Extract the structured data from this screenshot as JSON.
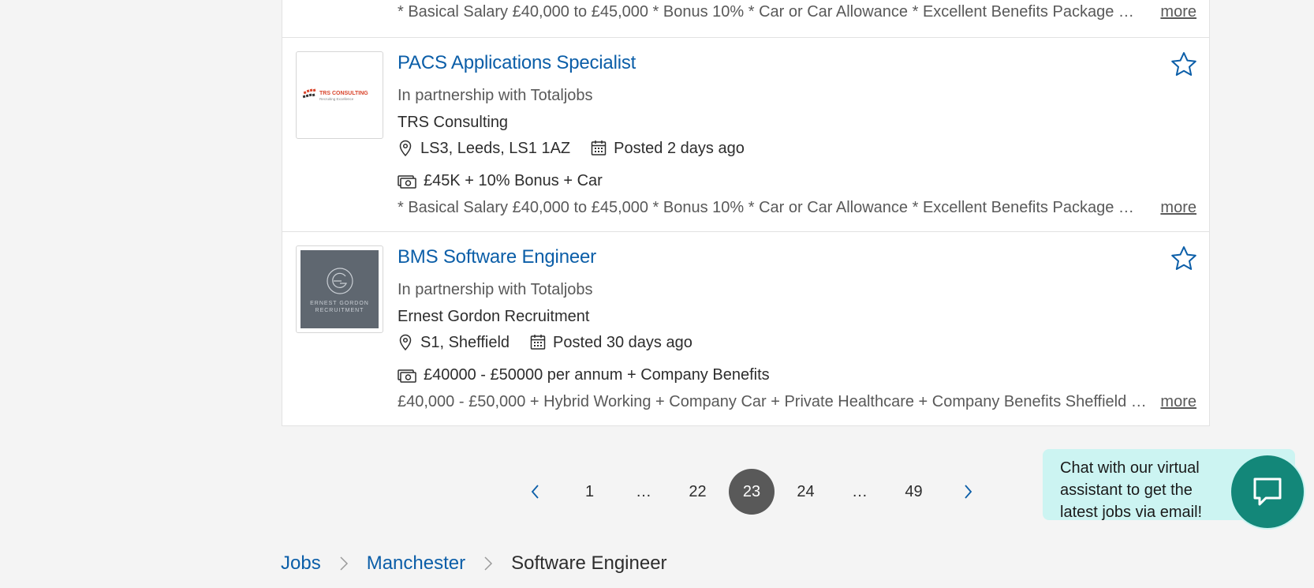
{
  "jobs": [
    {
      "partial": true,
      "description": "* Basical Salary £40,000 to £45,000 * Bonus 10% * Car or Car Allowance * Excellent Benefits Package …",
      "more_label": "more"
    },
    {
      "title": "PACS Applications Specialist",
      "partner": "In partnership with Totaljobs",
      "company": "TRS Consulting",
      "location": "LS3, Leeds, LS1 1AZ",
      "posted": "Posted 2 days ago",
      "salary": "£45K + 10% Bonus + Car",
      "description": "* Basical Salary £40,000 to £45,000 * Bonus 10% * Car or Car Allowance * Excellent Benefits Package …",
      "more_label": "more",
      "logo": {
        "name": "TRS CONSULTING",
        "tagline": "Recruiting Excellence"
      }
    },
    {
      "title": "BMS Software Engineer",
      "partner": "In partnership with Totaljobs",
      "company": "Ernest Gordon Recruitment",
      "location": "S1, Sheffield",
      "posted": "Posted 30 days ago",
      "salary": "£40000 - £50000 per annum + Company Benefits",
      "description": "£40,000 - £50,000 + Hybrid Working + Company Car + Private Healthcare + Company Benefits Sheffield …",
      "more_label": "more",
      "logo": {
        "line1": "ERNEST GORDON",
        "line2": "RECRUITMENT"
      }
    }
  ],
  "pagination": {
    "pages": [
      "1",
      "…",
      "22",
      "23",
      "24",
      "…",
      "49"
    ],
    "current": "23"
  },
  "chat": {
    "message": "Chat with our virtual assistant to get the latest jobs via email!"
  },
  "breadcrumb": {
    "items": [
      "Jobs",
      "Manchester"
    ],
    "current": "Software Engineer"
  },
  "colors": {
    "link": "#0b5ea8",
    "active_page": "#595959",
    "chat_bubble": "#ccf4f2",
    "chat_button": "#138779"
  }
}
